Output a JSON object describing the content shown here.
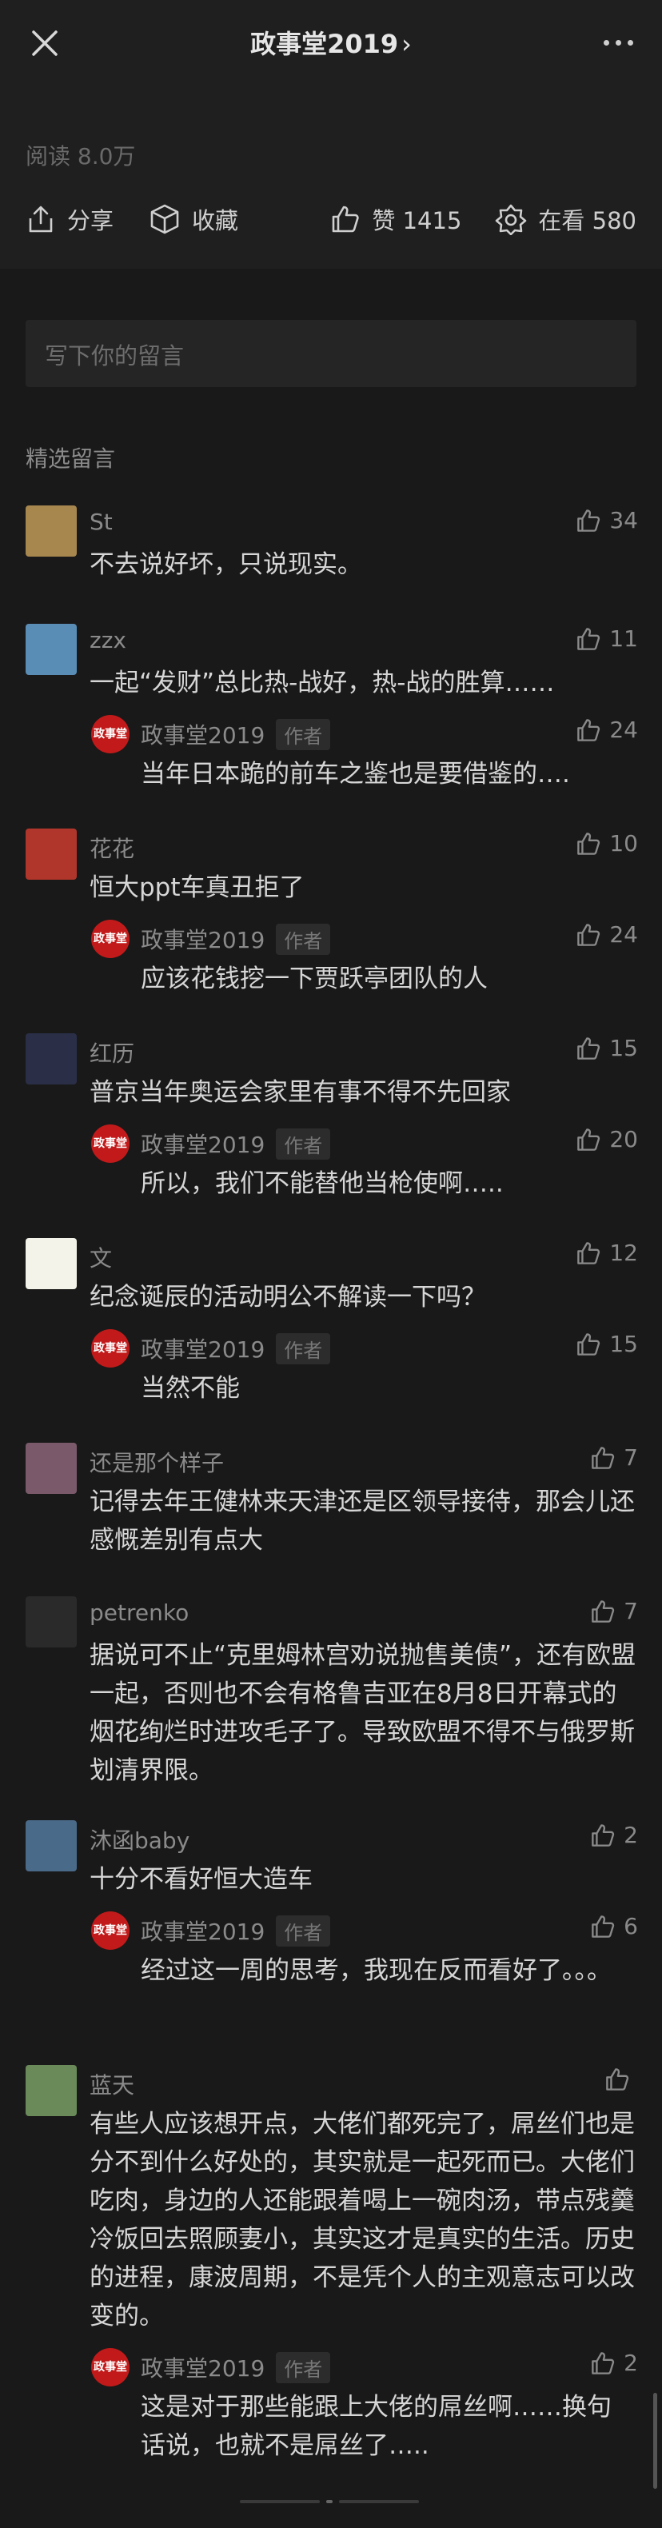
{
  "header": {
    "title": "政事堂2019",
    "chevron": "›"
  },
  "stats": {
    "reads": "阅读 8.0万",
    "share": "分享",
    "collect": "收藏",
    "likes": "赞 1415",
    "watching": "在看 580"
  },
  "input": {
    "placeholder": "写下你的留言"
  },
  "section_title": "精选留言",
  "comments": [
    {
      "name": "St",
      "text": "不去说好坏，只说现实。",
      "likes": "34"
    },
    {
      "name": "zzx",
      "text": "一起“发财”总比热-战好，热-战的胜算……",
      "likes": "11",
      "reply": {
        "name": "政事堂2019",
        "badge": "作者",
        "text": "当年日本跪的前车之鉴也是要借鉴的….",
        "likes": "24"
      }
    },
    {
      "name": "花花",
      "text": "恒大ppt车真丑拒了",
      "likes": "10",
      "reply": {
        "name": "政事堂2019",
        "badge": "作者",
        "text": "应该花钱挖一下贾跃亭团队的人",
        "likes": "24"
      }
    },
    {
      "name": "红历",
      "text": "普京当年奥运会家里有事不得不先回家",
      "likes": "15",
      "reply": {
        "name": "政事堂2019",
        "badge": "作者",
        "text": "所以，我们不能替他当枪使啊…..",
        "likes": "20"
      }
    },
    {
      "name": "文",
      "text": "纪念诞辰的活动明公不解读一下吗？",
      "likes": "12",
      "reply": {
        "name": "政事堂2019",
        "badge": "作者",
        "text": "当然不能",
        "likes": "15"
      }
    },
    {
      "name": "还是那个样子",
      "text": "记得去年王健林来天津还是区领导接待，那会儿还感慨差别有点大",
      "likes": "7"
    },
    {
      "name": "petrenko",
      "text": "据说可不止“克里姆林宫劝说抛售美债”，还有欧盟一起，否则也不会有格鲁吉亚在8月8日开幕式的烟花绚烂时进攻毛子了。导致欧盟不得不与俄罗斯划清界限。",
      "likes": "7"
    },
    {
      "name": "沐函baby",
      "text": "十分不看好恒大造车",
      "likes": "2",
      "reply": {
        "name": "政事堂2019",
        "badge": "作者",
        "text": "经过这一周的思考，我现在反而看好了。。。",
        "likes": "6"
      }
    },
    {
      "name": "蓝天",
      "text": "有些人应该想开点，大佬们都死完了，屌丝们也是分不到什么好处的，其实就是一起死而已。大佬们吃肉，身边的人还能跟着喝上一碗肉汤，带点残羹冷饭回去照顾妻小，其实这才是真实的生活。历史的进程，康波周期，不是凭个人的主观意志可以改变的。",
      "likes": "",
      "reply": {
        "name": "政事堂2019",
        "badge": "作者",
        "text": "这是对于那些能跟上大佬的屌丝啊……换句话说，也就不是屌丝了…..",
        "likes": "2"
      }
    }
  ],
  "avatar_colors": [
    "#a8874f",
    "#5a8db5",
    "#b0352a",
    "#2a2f47",
    "#f3f3ea",
    "#7a5a6a",
    "#2a2a2a",
    "#4a6a8a",
    "#6a8a5a"
  ],
  "reply_avatar_text": "政事堂"
}
